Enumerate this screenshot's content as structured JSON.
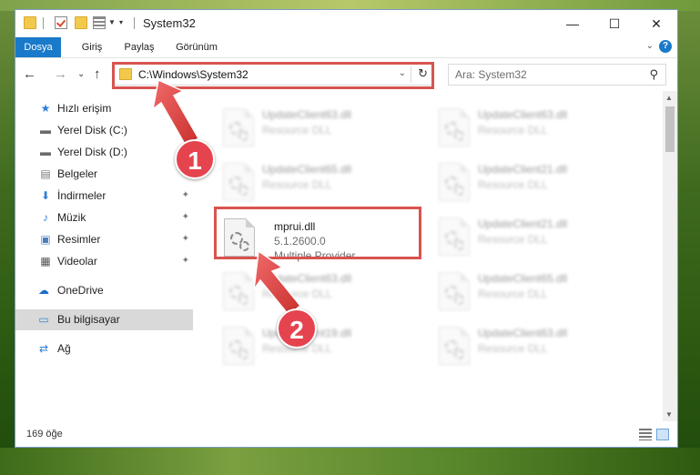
{
  "window": {
    "title": "System32",
    "min_glyph": "—",
    "max_glyph": "☐",
    "close_glyph": "✕"
  },
  "ribbon": {
    "tabs": [
      "Dosya",
      "Giriş",
      "Paylaş",
      "Görünüm"
    ],
    "help_glyph": "?",
    "collapse_glyph": "⌄"
  },
  "nav": {
    "back_glyph": "←",
    "forward_glyph": "→",
    "recent_glyph": "⌄",
    "up_glyph": "↑",
    "address": "C:\\Windows\\System32",
    "address_drop_glyph": "⌄",
    "refresh_glyph": "↻"
  },
  "search": {
    "placeholder": "Ara: System32",
    "icon_glyph": "⚲"
  },
  "sidebar": {
    "items": [
      {
        "label": "Hızlı erişim",
        "icon": "star-icon",
        "glyph": "★",
        "color": "#2f7fd6",
        "pinned": false
      },
      {
        "label": "Yerel Disk (C:)",
        "icon": "drive-icon",
        "glyph": "▬",
        "color": "#6b6b6b",
        "pinned": false
      },
      {
        "label": "Yerel Disk (D:)",
        "icon": "drive-icon",
        "glyph": "▬",
        "color": "#6b6b6b",
        "pinned": false
      },
      {
        "label": "Belgeler",
        "icon": "documents-icon",
        "glyph": "▤",
        "color": "#7a7a7a",
        "pinned": false
      },
      {
        "label": "İndirmeler",
        "icon": "download-icon",
        "glyph": "⬇",
        "color": "#2f7fd6",
        "pinned": true
      },
      {
        "label": "Müzik",
        "icon": "music-icon",
        "glyph": "♪",
        "color": "#2f7fd6",
        "pinned": true
      },
      {
        "label": "Resimler",
        "icon": "pictures-icon",
        "glyph": "▣",
        "color": "#4a7fb8",
        "pinned": true
      },
      {
        "label": "Videolar",
        "icon": "video-icon",
        "glyph": "▦",
        "color": "#555555",
        "pinned": true
      },
      {
        "label": "OneDrive",
        "icon": "cloud-icon",
        "glyph": "☁",
        "color": "#1a6fc9",
        "pinned": false
      },
      {
        "label": "Bu bilgisayar",
        "icon": "computer-icon",
        "glyph": "▭",
        "color": "#2f8ad6",
        "pinned": false,
        "selected": true
      },
      {
        "label": "Ağ",
        "icon": "network-icon",
        "glyph": "⇄",
        "color": "#2f7fd6",
        "pinned": false
      }
    ],
    "pin_glyph": "📌"
  },
  "files": {
    "main": {
      "name": "mprui.dll",
      "version": "5.1.2600.0",
      "description": "Multiple Provider"
    },
    "background": [
      {
        "name": "UpdateClient63.dll",
        "type": "Resource DLL"
      },
      {
        "name": "UpdateClient63.dll",
        "type": "Resource DLL"
      },
      {
        "name": "UpdateClient65.dll",
        "type": "Resource DLL"
      },
      {
        "name": "UpdateClient21.dll",
        "type": "Resource DLL"
      },
      {
        "name": "UpdateClient21.dll",
        "type": "Resource DLL"
      },
      {
        "name": "UpdateClient63.dll",
        "type": "Resource DLL"
      },
      {
        "name": "UpdateClient65.dll",
        "type": "Resource DLL"
      },
      {
        "name": "UpdateClient19.dll",
        "type": "Resource DLL"
      },
      {
        "name": "UpdateClient63.dll",
        "type": "Resource DLL"
      }
    ]
  },
  "status": {
    "count_text": "169 öğe"
  },
  "annotations": {
    "badge1": "1",
    "badge2": "2",
    "color": "#e5444f"
  }
}
